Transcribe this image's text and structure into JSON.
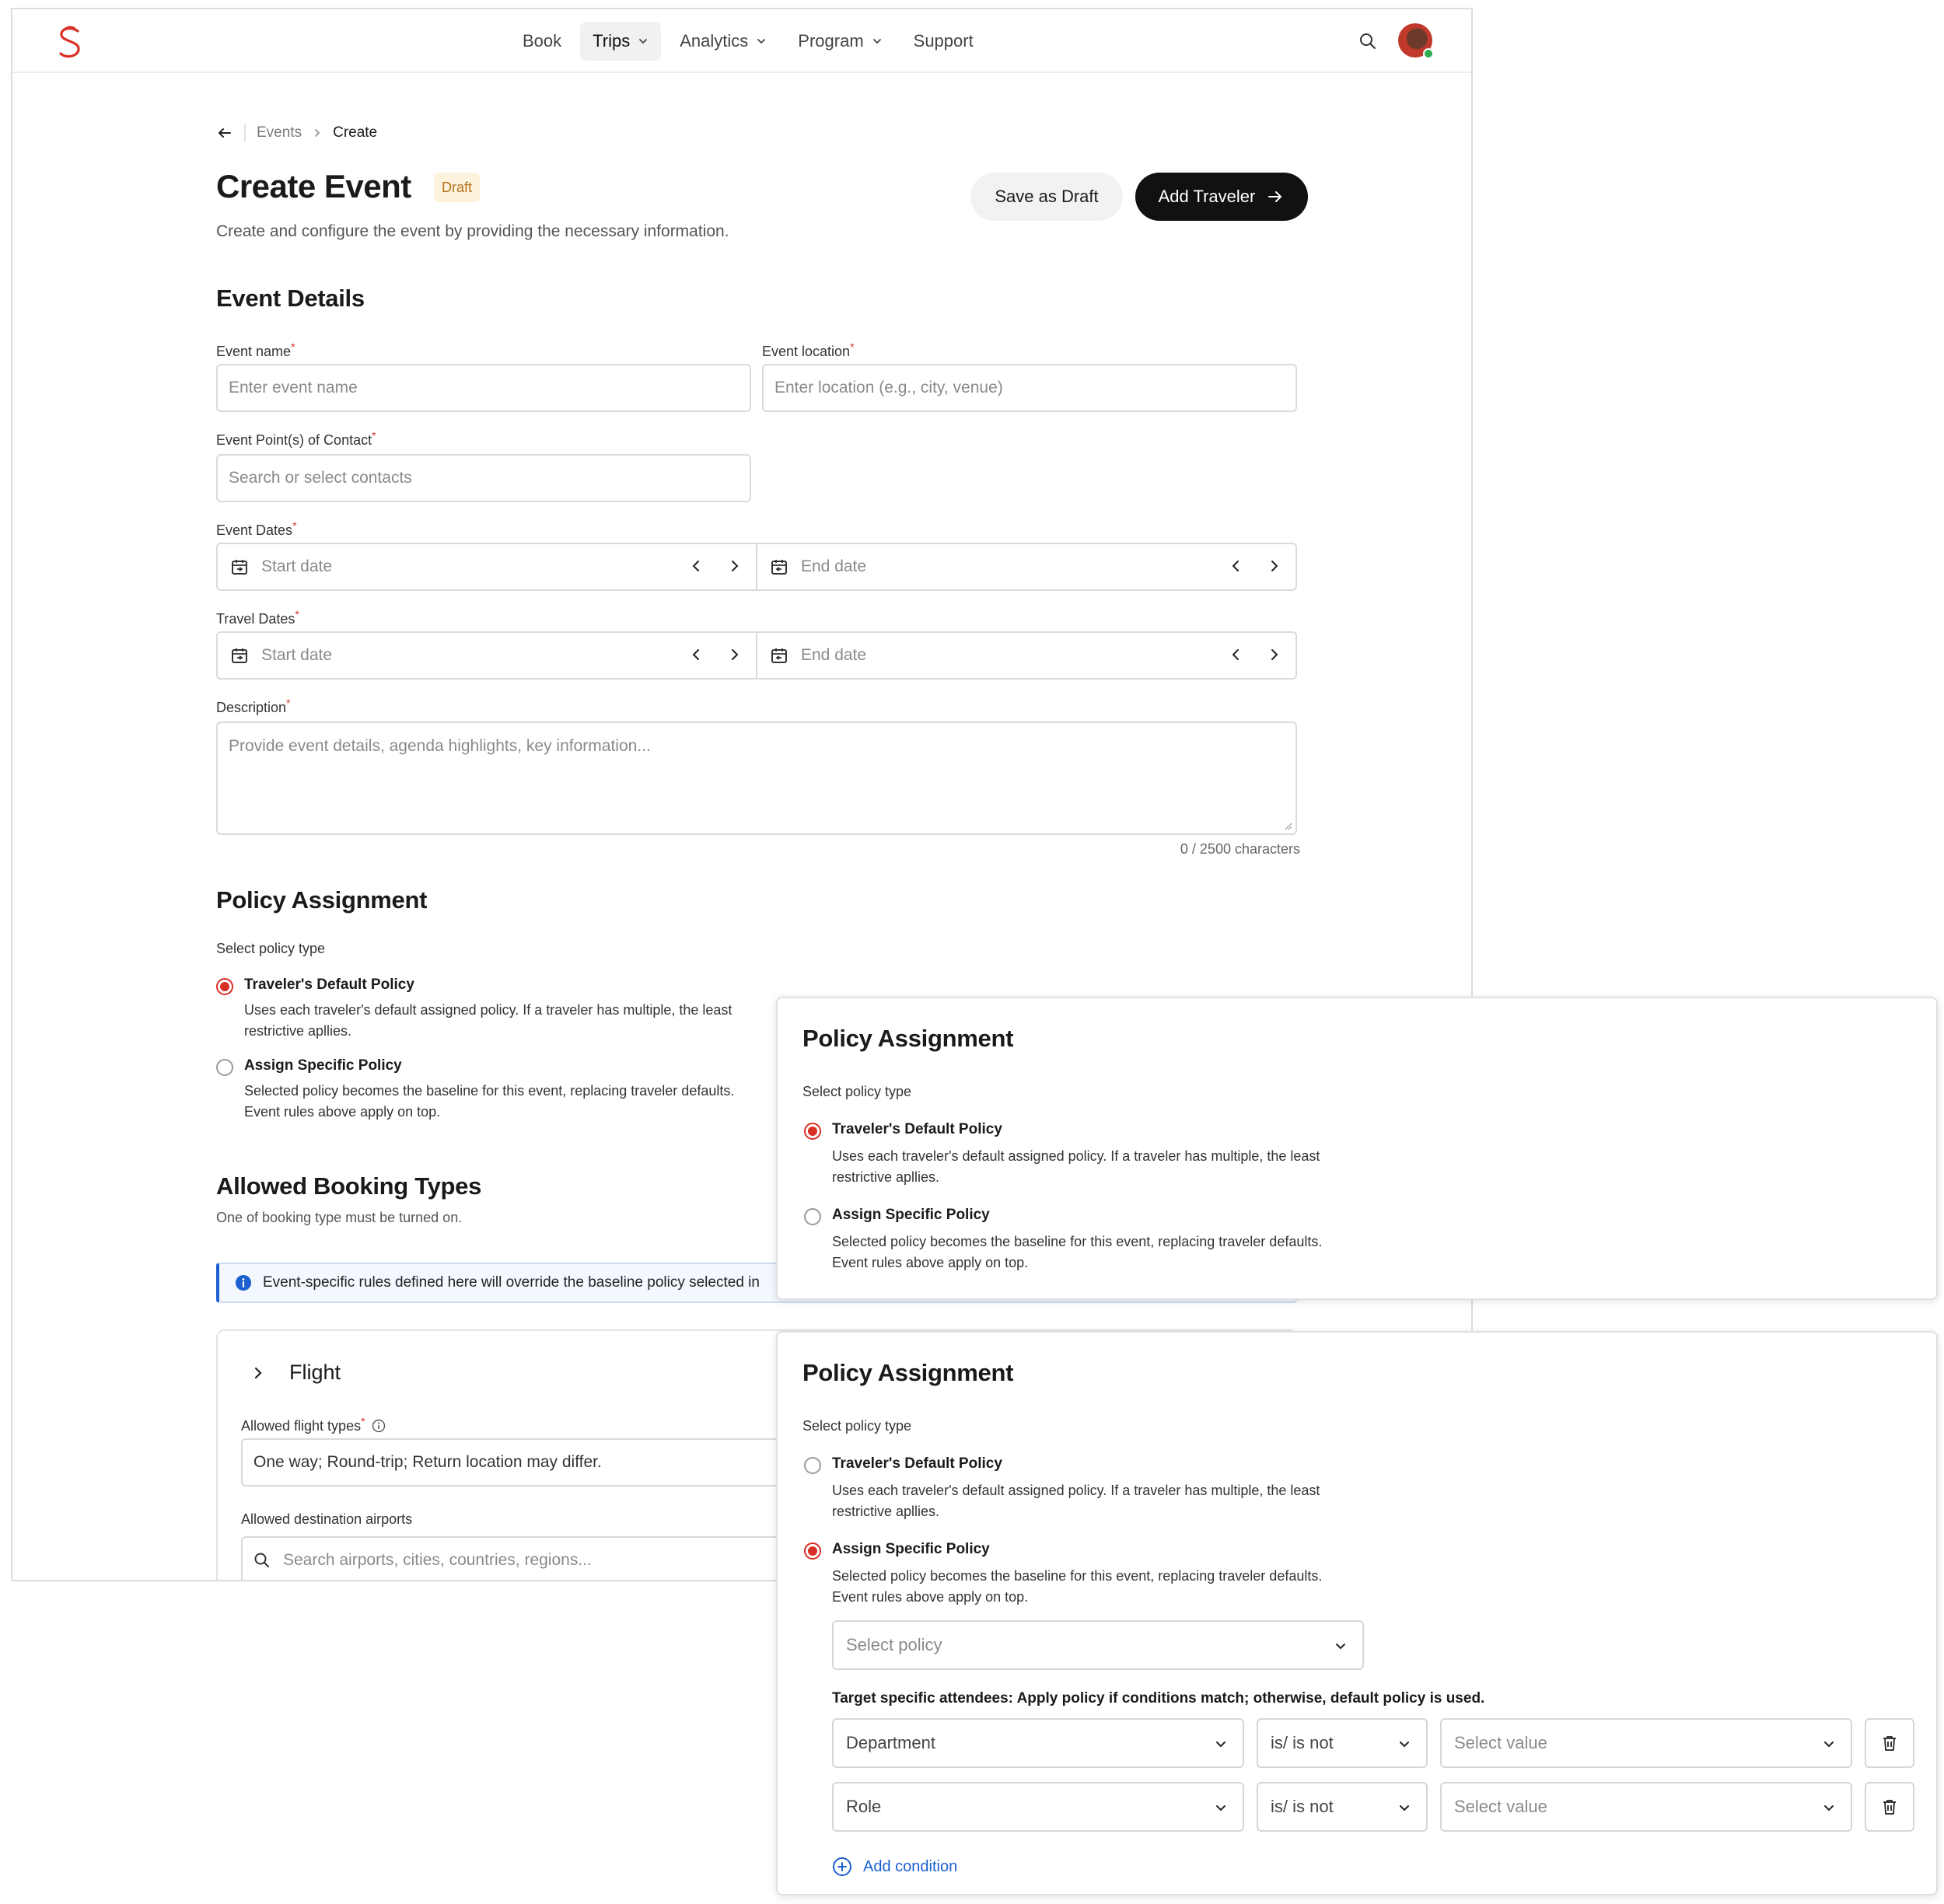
{
  "nav": {
    "items": [
      {
        "label": "Book",
        "dropdown": false,
        "active": false
      },
      {
        "label": "Trips",
        "dropdown": true,
        "active": true
      },
      {
        "label": "Analytics",
        "dropdown": true,
        "active": false
      },
      {
        "label": "Program",
        "dropdown": true,
        "active": false
      },
      {
        "label": "Support",
        "dropdown": false,
        "active": false
      }
    ],
    "logo_icon": "s-logo-icon",
    "search_icon": "search-icon",
    "status_color": "#2eae4f"
  },
  "breadcrumb": {
    "parent": "Events",
    "current": "Create"
  },
  "header": {
    "title": "Create Event",
    "badge": "Draft",
    "subtitle": "Create and configure the event by providing the necessary information.",
    "save_draft_label": "Save as Draft",
    "primary_label": "Add Traveler"
  },
  "event_details": {
    "title": "Event Details",
    "name_label": "Event name",
    "name_placeholder": "Enter event name",
    "location_label": "Event location",
    "location_placeholder": "Enter location (e.g., city, venue)",
    "contact_label": "Event Point(s) of Contact",
    "contact_placeholder": "Search or select contacts",
    "event_dates_label": "Event Dates",
    "travel_dates_label": "Travel Dates",
    "start_placeholder": "Start date",
    "end_placeholder": "End date",
    "description_label": "Description",
    "description_placeholder": "Provide event details, agenda highlights, key information...",
    "char_count": "0 / 2500 characters"
  },
  "policy": {
    "title": "Policy Assignment",
    "select_label": "Select policy type",
    "default_title": "Traveler's Default Policy",
    "default_desc": "Uses each traveler's default assigned policy. If a traveler has multiple, the least restrictive apllies.",
    "specific_title": "Assign Specific Policy",
    "specific_desc": "Selected policy becomes the baseline for this event, replacing traveler defaults. Event rules above apply on top.",
    "select_policy_placeholder": "Select policy",
    "target_text": "Target specific attendees: Apply policy if conditions match; otherwise, default policy is used.",
    "conditions": [
      {
        "field": "Department",
        "operator": "is/ is not",
        "value": "Select value"
      },
      {
        "field": "Role",
        "operator": "is/ is not",
        "value": "Select value"
      }
    ],
    "add_condition": "Add condition"
  },
  "booking": {
    "title": "Allowed Booking Types",
    "subtitle": "One of booking type must be turned on.",
    "info": "Event-specific rules defined here will override the baseline policy selected in",
    "flight_title": "Flight",
    "flight_types_label": "Allowed flight types",
    "flight_types_value": "One way; Round-trip; Return location may differ.",
    "destination_label": "Allowed destination airports",
    "destination_placeholder": "Search airports, cities, countries, regions..."
  },
  "colors": {
    "accent": "#d93025",
    "link": "#1b5fd0",
    "badge_bg": "#fdf3dc",
    "badge_text": "#b5701a"
  }
}
